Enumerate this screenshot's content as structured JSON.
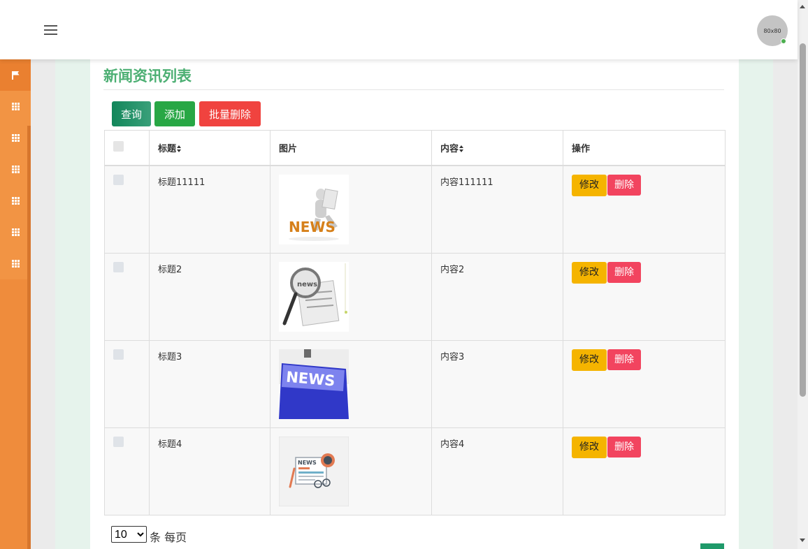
{
  "header": {
    "menu_icon": "hamburger-icon",
    "avatar_text": "80x80"
  },
  "sidebar": {
    "items": [
      {
        "icon": "flag-icon",
        "active": true
      },
      {
        "icon": "grid-icon"
      },
      {
        "icon": "grid-icon"
      },
      {
        "icon": "grid-icon"
      },
      {
        "icon": "grid-icon"
      },
      {
        "icon": "grid-icon"
      },
      {
        "icon": "grid-icon"
      }
    ]
  },
  "page": {
    "title": "新闻资讯列表"
  },
  "toolbar": {
    "query_label": "查询",
    "add_label": "添加",
    "batch_delete_label": "批量删除"
  },
  "table": {
    "headers": {
      "title": "标题",
      "image": "图片",
      "content": "内容",
      "actions": "操作"
    },
    "rows": [
      {
        "title": "标题11111",
        "content": "内容111111",
        "image": "news-3d-figure-image",
        "edit": "修改",
        "delete": "删除"
      },
      {
        "title": "标题2",
        "content": "内容2",
        "image": "magnifier-newspaper-image",
        "edit": "修改",
        "delete": "删除"
      },
      {
        "title": "标题3",
        "content": "内容3",
        "image": "news-key-image",
        "edit": "修改",
        "delete": "删除"
      },
      {
        "title": "标题4",
        "content": "内容4",
        "image": "news-flat-illustration-image",
        "edit": "修改",
        "delete": "删除"
      }
    ]
  },
  "pagination": {
    "page_size": "10",
    "page_size_suffix": "条 每页"
  },
  "colors": {
    "sidebar": "#ef8c3c",
    "title": "#4caf73",
    "add": "#28a745",
    "danger": "#f0433f",
    "warning": "#f5b400"
  }
}
